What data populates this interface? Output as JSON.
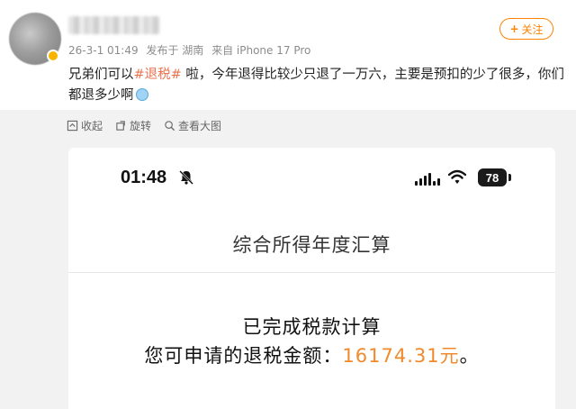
{
  "post": {
    "username": "",
    "meta": {
      "date": "26-3-1 01:49",
      "location": "发布于 湖南",
      "source": "来自 iPhone 17 Pro"
    },
    "follow_label": "关注",
    "text_prefix": "兄弟们可以",
    "hashtag": "#退税#",
    "text_suffix": " 啦，今年退得比较少只退了一万六，主要是预扣的少了很多，你们都退多少啊"
  },
  "image_toolbar": {
    "collapse_label": "收起",
    "rotate_label": "旋转",
    "view_large_label": "查看大图"
  },
  "phone": {
    "status_time": "01:48",
    "battery": "78",
    "page_title": "综合所得年度汇算",
    "done_text": "已完成税款计算",
    "refund_prefix": "您可申请的退税金额：",
    "refund_amount": "16174.31元",
    "refund_suffix": "。"
  },
  "colors": {
    "accent": "#ff8200",
    "hashtag": "#eb7350",
    "amount": "#f08a2c"
  }
}
